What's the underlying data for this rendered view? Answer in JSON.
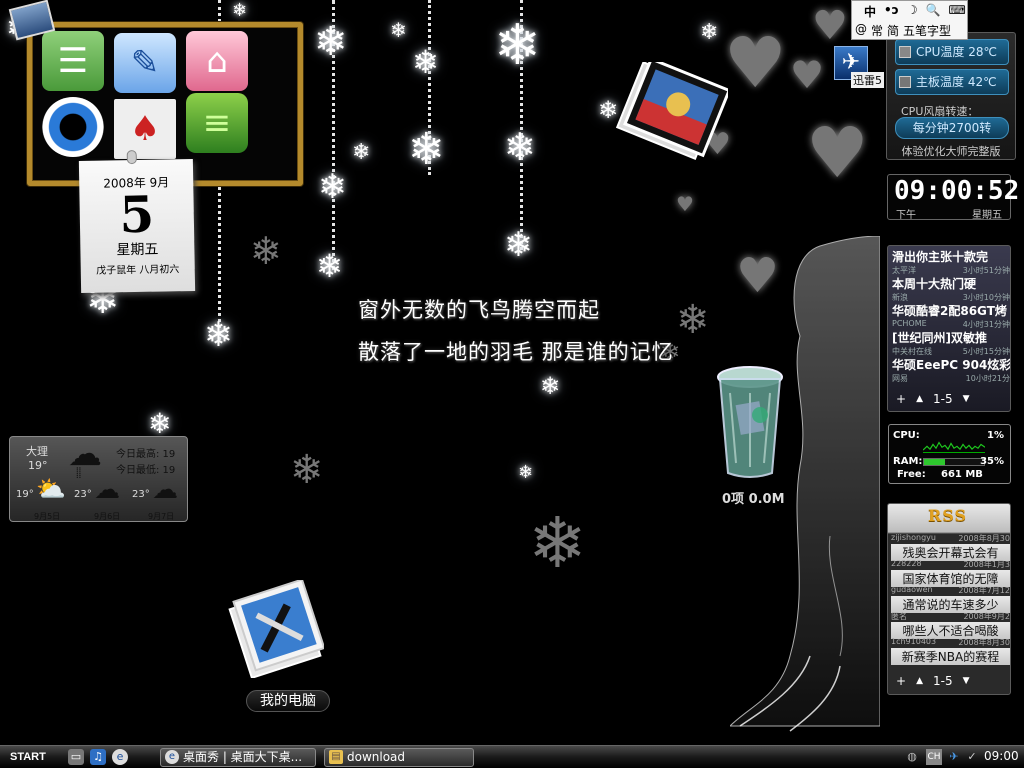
{
  "lyrics": {
    "line1": "窗外无数的飞鸟腾空而起",
    "line2": "散落了一地的羽毛 那是谁的记忆"
  },
  "calendar": {
    "year_month": "2008年  9月",
    "day": "5",
    "weekday": "星期五",
    "lunar": "戊子鼠年 八月初六"
  },
  "weather": {
    "city": "大理",
    "current_temp": "19°",
    "high_label": "今日最高: 19",
    "low_label": "今日最低: 19",
    "forecast": [
      {
        "temp": "19°",
        "date": "9月5日"
      },
      {
        "temp": "23°",
        "date": "9月6日"
      },
      {
        "temp": "23°",
        "date": "9月7日"
      }
    ]
  },
  "desktop_icons": {
    "my_computer": "我的电脑",
    "recycle_bin": "0项 0.0M"
  },
  "ime": {
    "row1": [
      "中",
      "•ɔ",
      "☽",
      "🔍",
      "⌨"
    ],
    "row2": [
      "@",
      "常",
      "简",
      "五笔字型"
    ]
  },
  "xunlei": {
    "label": "迅雷5"
  },
  "system_monitor": {
    "cpu_temp": "CPU温度  28℃",
    "board_temp": "主板温度  42℃",
    "fan_title": "CPU风扇转速：",
    "fan_speed": "每分钟2700转",
    "footer": "体验优化大师完整版"
  },
  "clock": {
    "time": "09:00:52",
    "ampm": "下午",
    "weekday": "星期五"
  },
  "news": {
    "items": [
      {
        "title": "滑出你主张十款完",
        "source": "太平洋",
        "time": "3小时51分钟"
      },
      {
        "title": "本周十大热门硬",
        "source": "新浪",
        "time": "3小时10分钟"
      },
      {
        "title": "华硕酷睿2配86GT烤",
        "source": "PCHOME",
        "time": "4小时31分钟"
      },
      {
        "title": "[世纪同州]双敏推",
        "source": "中关村在线",
        "time": "5小时15分钟"
      },
      {
        "title": "华硕EeePC 904炫彩",
        "source": "网易",
        "time": "10小时21分"
      }
    ],
    "pager": "1-5"
  },
  "cpu_meter": {
    "cpu_label": "CPU:",
    "cpu_value": "1%",
    "ram_label": "RAM:",
    "ram_value": "35%",
    "ram_fraction": 0.35,
    "free_label": "Free:",
    "free_value": "661 MB"
  },
  "rss": {
    "logo": "RSS",
    "items": [
      {
        "user": "zijishongyu",
        "date": "2008年8月30",
        "title": "残奥会开幕式会有"
      },
      {
        "user": "228228",
        "date": "2008年1月3",
        "title": "国家体育馆的无障"
      },
      {
        "user": "gudaowen",
        "date": "2008年7月12",
        "title": "通常说的车速多少"
      },
      {
        "user": "匿名",
        "date": "2008年9月2",
        "title": "哪些人不适合喝酸"
      },
      {
        "user": "1ch910403",
        "date": "2008年8月30",
        "title": "新赛季NBA的赛程"
      }
    ],
    "pager": "1-5"
  },
  "taskbar": {
    "start": "START",
    "tasks": [
      "桌面秀 | 桌面大下桌...",
      "download"
    ],
    "time": "09:00"
  }
}
